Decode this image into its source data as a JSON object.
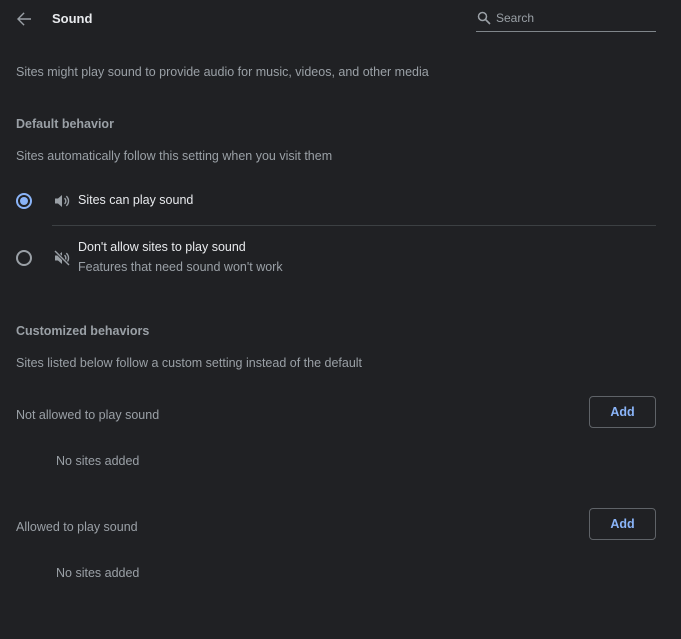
{
  "header": {
    "title": "Sound",
    "search_placeholder": "Search"
  },
  "intro_text": "Sites might play sound to provide audio for music, videos, and other media",
  "default_behavior": {
    "heading": "Default behavior",
    "description": "Sites automatically follow this setting when you visit them",
    "options": [
      {
        "label": "Sites can play sound",
        "sublabel": "",
        "selected": true,
        "icon": "speaker-icon"
      },
      {
        "label": "Don't allow sites to play sound",
        "sublabel": "Features that need sound won't work",
        "selected": false,
        "icon": "speaker-muted-icon"
      }
    ]
  },
  "customized_behaviors": {
    "heading": "Customized behaviors",
    "description": "Sites listed below follow a custom setting instead of the default",
    "lists": [
      {
        "title": "Not allowed to play sound",
        "add_label": "Add",
        "empty_text": "No sites added"
      },
      {
        "title": "Allowed to play sound",
        "add_label": "Add",
        "empty_text": "No sites added"
      }
    ]
  },
  "colors": {
    "background": "#202124",
    "accent": "#8ab4f8",
    "primary_text": "#e8eaed",
    "secondary_text": "#9aa0a6"
  }
}
